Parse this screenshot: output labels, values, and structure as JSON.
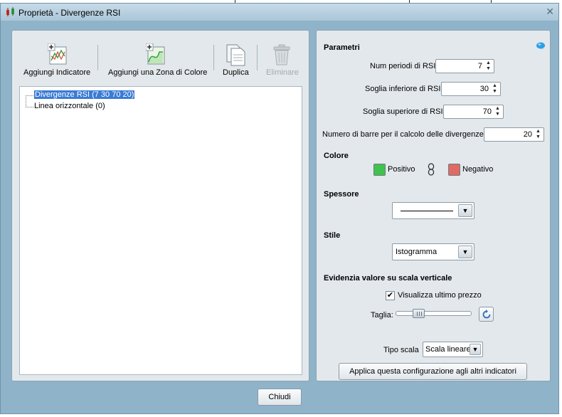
{
  "window": {
    "title": "Proprietà - Divergenze RSI",
    "close_glyph": "✕"
  },
  "toolbar": {
    "add_indicator_label": "Aggiungi Indicatore",
    "add_color_zone_label": "Aggiungi una Zona di Colore",
    "duplicate_label": "Duplica",
    "delete_label": "Eliminare"
  },
  "tree": {
    "items": [
      {
        "label": "Divergenze RSI (7 30 70 20)",
        "selected": true
      },
      {
        "label": "Linea orizzontale (0)",
        "selected": false
      }
    ]
  },
  "params": {
    "section_title": "Parametri",
    "rsi_periods_label": "Num periodi di RSI",
    "rsi_periods_value": "7",
    "lower_threshold_label": "Soglia inferiore di RSI",
    "lower_threshold_value": "30",
    "upper_threshold_label": "Soglia superiore di RSI",
    "upper_threshold_value": "70",
    "bars_label": "Numero di barre per il calcolo delle divergenze",
    "bars_value": "20"
  },
  "color": {
    "section_title": "Colore",
    "positive_label": "Positivo",
    "positive_color": "#3fc34d",
    "negative_label": "Negativo",
    "negative_color": "#e06a64"
  },
  "thickness": {
    "section_title": "Spessore"
  },
  "style": {
    "section_title": "Stile",
    "selected": "Istogramma"
  },
  "highlight": {
    "section_title": "Evidenzia valore su scala verticale",
    "show_last_price_label": "Visualizza ultimo prezzo",
    "show_last_price_checked": true,
    "size_label": "Taglia:",
    "size_level": 0.3
  },
  "scale": {
    "label": "Tipo scala",
    "selected": "Scala lineare"
  },
  "apply_button_label": "Applica questa configurazione agli altri indicatori",
  "close_button_label": "Chiudi"
}
